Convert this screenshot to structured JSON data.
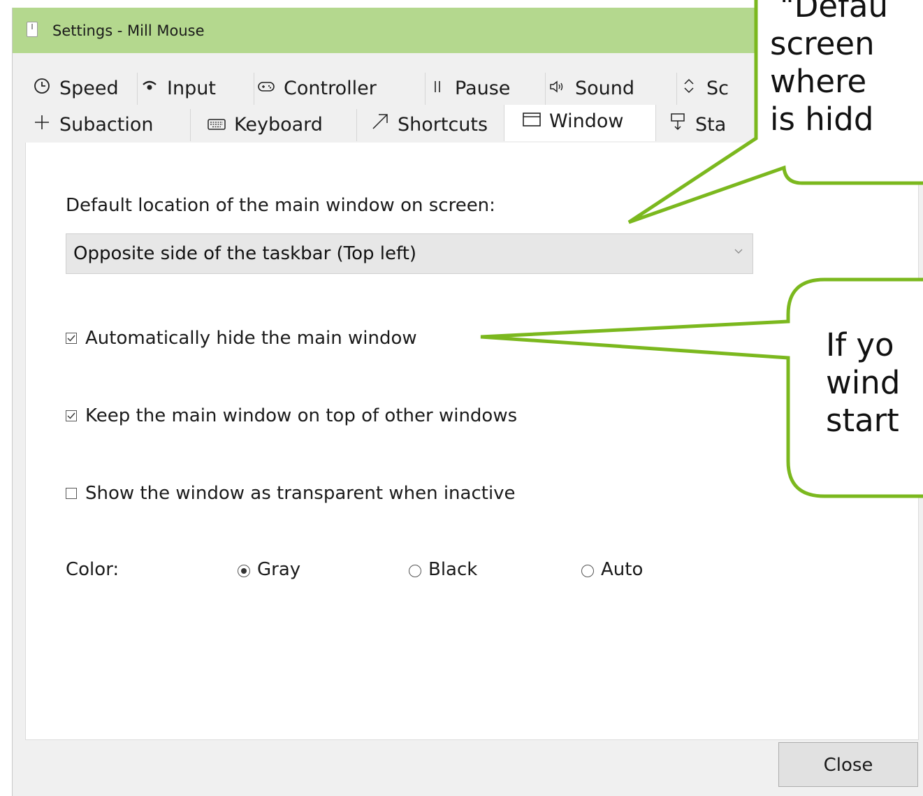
{
  "window": {
    "title": "Settings - Mill Mouse"
  },
  "tabs_row1": [
    {
      "icon": "clock-icon",
      "glyph": "🕒",
      "label": "Speed"
    },
    {
      "icon": "input-icon",
      "glyph": "⌔",
      "label": "Input"
    },
    {
      "icon": "gamepad-icon",
      "glyph": "🎮",
      "label": "Controller"
    },
    {
      "icon": "pause-icon",
      "glyph": "‖",
      "label": "Pause"
    },
    {
      "icon": "speaker-icon",
      "glyph": "🔊",
      "label": "Sound"
    },
    {
      "icon": "scroll-icon",
      "glyph": "⇕",
      "label": "Sc"
    }
  ],
  "tabs_row2": [
    {
      "icon": "plus-icon",
      "glyph": "+",
      "label": "Subaction"
    },
    {
      "icon": "keyboard-icon",
      "glyph": "⌨",
      "label": "Keyboard"
    },
    {
      "icon": "arrow-icon",
      "glyph": "↗",
      "label": "Shortcuts"
    },
    {
      "icon": "window-icon",
      "glyph": "🗔",
      "label": "Window"
    },
    {
      "icon": "startup-icon",
      "glyph": "⍑",
      "label": "Sta"
    }
  ],
  "panel": {
    "location_label": "Default location of the main window on screen:",
    "location_value": "Opposite side of the taskbar (Top left)",
    "auto_hide": {
      "label": "Automatically hide the main window",
      "checked": true
    },
    "keep_on_top": {
      "label": "Keep the main window on top of other windows",
      "checked": true
    },
    "transparent": {
      "label": "Show the window as transparent when inactive",
      "checked": false
    },
    "color_label": "Color:",
    "color_options": [
      {
        "label": "Gray",
        "selected": true
      },
      {
        "label": "Black",
        "selected": false
      },
      {
        "label": "Auto",
        "selected": false
      }
    ]
  },
  "close_label": "Close",
  "callout1": {
    "lines": [
      "\"Defau",
      "screen",
      "where",
      "is hidd"
    ]
  },
  "callout2": {
    "lines": [
      "If yo",
      "wind",
      "start"
    ]
  },
  "colors": {
    "titlebar": "#b4d88e",
    "callout_border": "#7bb81e"
  }
}
